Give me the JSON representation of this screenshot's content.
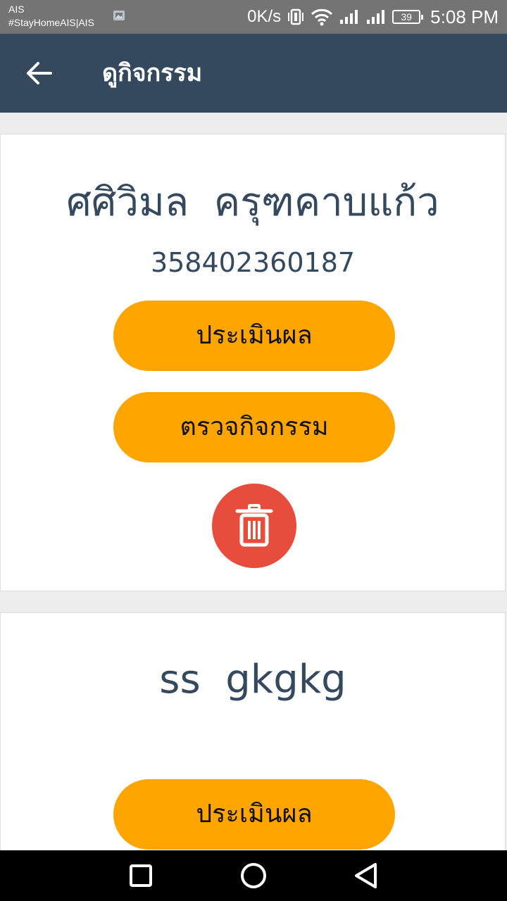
{
  "status_bar": {
    "carrier_line1": "AIS",
    "carrier_line2": "#StayHomeAIS|AIS",
    "net_speed": "0K/s",
    "battery": "39",
    "time": "5:08 PM",
    "icons": [
      "image-notification-icon",
      "vibrate-icon",
      "wifi-icon",
      "signal-icon",
      "signal-icon",
      "battery-icon"
    ]
  },
  "app_bar": {
    "title": "ดูกิจกรรม",
    "back_icon": "arrow-left-icon"
  },
  "cards": [
    {
      "name": "ศศิวิมล  ครุฑคาบแก้ว",
      "id": "358402360187",
      "evaluate_label": "ประเมินผล",
      "check_label": "ตรวจกิจกรรม",
      "delete_icon": "trash-icon"
    },
    {
      "name": "ss  gkgkg",
      "id": "",
      "evaluate_label": "ประเมินผล"
    }
  ],
  "nav_bar": {
    "icons": [
      "recent-apps-icon",
      "home-icon",
      "back-icon"
    ]
  },
  "colors": {
    "app_bar": "#34495e",
    "accent_button": "#ffa500",
    "delete_button": "#e74c3c",
    "text": "#34495e"
  }
}
